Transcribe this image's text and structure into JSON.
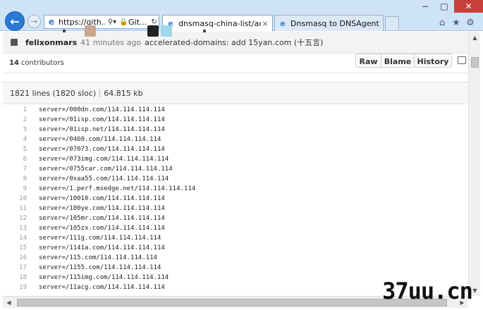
{
  "browser": {
    "address": {
      "url": "https://gith...",
      "search_symbol": "⚲▾",
      "lock_symbol": "🔒",
      "site_label": "Git...",
      "refresh_symbol": "↻"
    },
    "tabs": [
      {
        "title": "dnsmasq-china-list/accel...",
        "close": "×"
      },
      {
        "title": "Dnsmasq to DNSAgent Rule..."
      }
    ],
    "window": {
      "minimize": "−",
      "maximize": "□",
      "close": "✕"
    },
    "toolbar_icons": [
      "home-icon",
      "star-icon",
      "gear-icon"
    ]
  },
  "commit": {
    "author": "felixonmars",
    "ago": "41 minutes ago",
    "message": "accelerated-domains: add 15yan.com (十五言)"
  },
  "contributors": {
    "count": "14",
    "label": "contributors"
  },
  "file": {
    "lines": "1821 lines (1820 sloc)",
    "size": "64.815 kb",
    "buttons": {
      "raw": "Raw",
      "blame": "Blame",
      "history": "History"
    }
  },
  "code_lines": [
    {
      "n": "1",
      "text": "server=/000dn.com/114.114.114.114"
    },
    {
      "n": "2",
      "text": "server=/01isp.com/114.114.114.114"
    },
    {
      "n": "3",
      "text": "server=/01isp.net/114.114.114.114"
    },
    {
      "n": "4",
      "text": "server=/0460.com/114.114.114.114"
    },
    {
      "n": "5",
      "text": "server=/07073.com/114.114.114.114"
    },
    {
      "n": "6",
      "text": "server=/073img.com/114.114.114.114"
    },
    {
      "n": "7",
      "text": "server=/0755car.com/114.114.114.114"
    },
    {
      "n": "8",
      "text": "server=/0xaa55.com/114.114.114.114"
    },
    {
      "n": "9",
      "text": "server=/1.perf.msedge.net/114.114.114.114"
    },
    {
      "n": "10",
      "text": "server=/10010.com/114.114.114.114"
    },
    {
      "n": "11",
      "text": "server=/100ye.com/114.114.114.114"
    },
    {
      "n": "12",
      "text": "server=/105mr.com/114.114.114.114"
    },
    {
      "n": "13",
      "text": "server=/105zx.com/114.114.114.114"
    },
    {
      "n": "14",
      "text": "server=/111g.com/114.114.114.114"
    },
    {
      "n": "15",
      "text": "server=/1141a.com/114.114.114.114"
    },
    {
      "n": "16",
      "text": "server=/115.com/114.114.114.114"
    },
    {
      "n": "17",
      "text": "server=/1155.com/114.114.114.114"
    },
    {
      "n": "18",
      "text": "server=/115img.com/114.114.114.114"
    },
    {
      "n": "19",
      "text": "server=/11acg.com/114.114.114.114"
    }
  ],
  "watermark": "37uu.cn",
  "colors": {
    "chrome": "#cfe3f7",
    "back_button": "#2b79d6",
    "close_button": "#c7413a",
    "commit_bar": "#f3f3f3"
  }
}
